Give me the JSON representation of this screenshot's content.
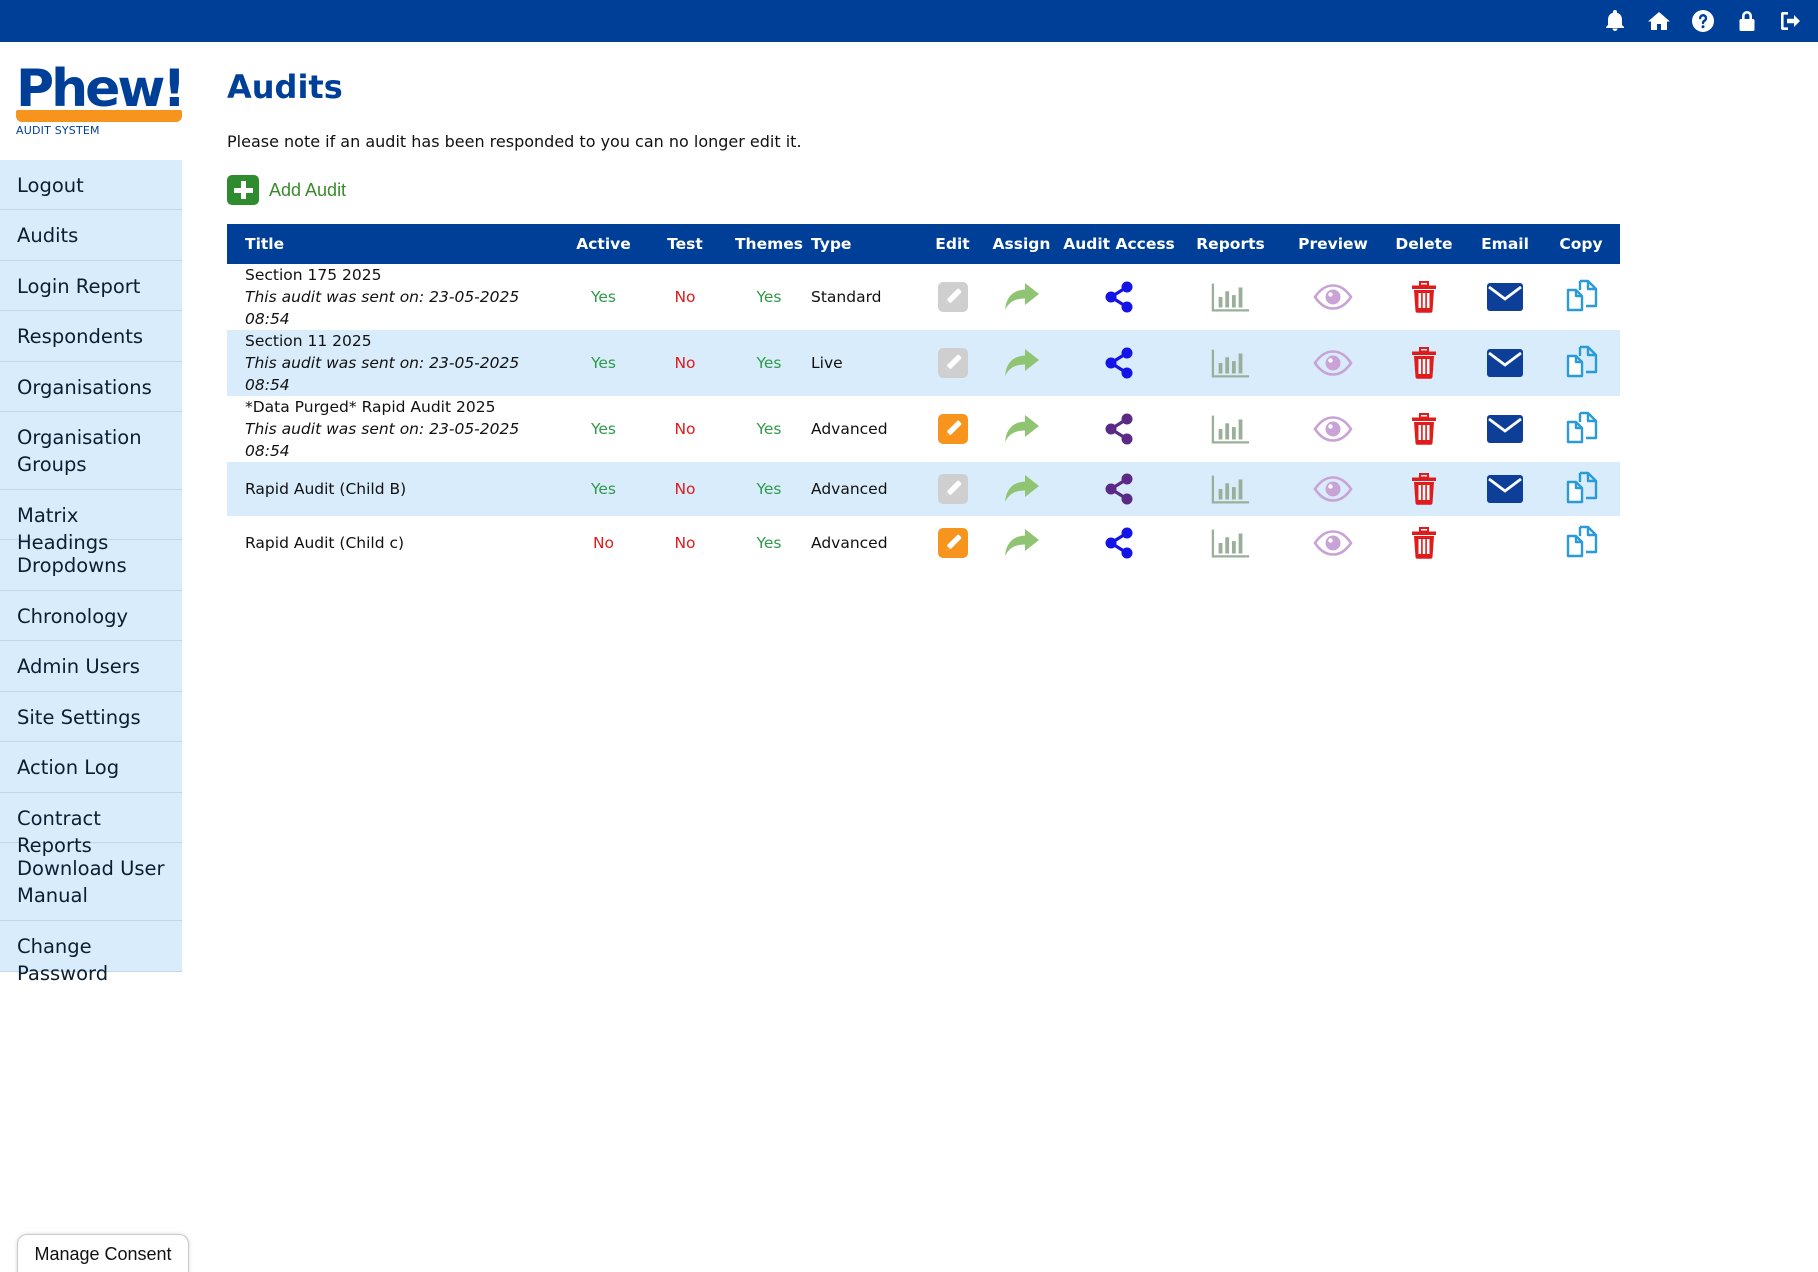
{
  "topbar": {
    "icons": [
      "bell-icon",
      "home-icon",
      "help-icon",
      "lock-icon",
      "logout-icon"
    ]
  },
  "logo": {
    "word": "Phew!",
    "sub": "AUDIT SYSTEM"
  },
  "sidebar": {
    "items": [
      "Logout",
      "Audits",
      "Login Report",
      "Respondents",
      "Organisations",
      "Organisation Groups",
      "Matrix Headings",
      "Dropdowns",
      "Chronology",
      "Admin Users",
      "Site Settings",
      "Action Log",
      "Contract Reports",
      "Download User Manual",
      "Change Password"
    ]
  },
  "main": {
    "title": "Audits",
    "note": "Please note if an audit has been responded to you can no longer edit it.",
    "add_label": "Add Audit"
  },
  "table": {
    "headers": [
      "Title",
      "Active",
      "Test",
      "Themes",
      "Type",
      "Edit",
      "Assign",
      "Audit Access",
      "Reports",
      "Preview",
      "Delete",
      "Email",
      "Copy"
    ],
    "rows": [
      {
        "title": "Section 175 2025",
        "sent": "This audit was sent on: 23-05-2025 08:54",
        "active": "Yes",
        "test": "No",
        "themes": "Yes",
        "type": "Standard",
        "editable": false,
        "share_color": "#1414e6",
        "email": true
      },
      {
        "title": "Section 11 2025",
        "sent": "This audit was sent on: 23-05-2025 08:54",
        "active": "Yes",
        "test": "No",
        "themes": "Yes",
        "type": "Live",
        "editable": false,
        "share_color": "#1414e6",
        "email": true
      },
      {
        "title": "*Data Purged* Rapid Audit 2025",
        "sent": "This audit was sent on: 23-05-2025 08:54",
        "active": "Yes",
        "test": "No",
        "themes": "Yes",
        "type": "Advanced",
        "editable": true,
        "share_color": "#5b2a86",
        "email": true
      },
      {
        "title": "Rapid Audit (Child B)",
        "sent": "",
        "active": "Yes",
        "test": "No",
        "themes": "Yes",
        "type": "Advanced",
        "editable": false,
        "share_color": "#5b2a86",
        "email": true
      },
      {
        "title": "Rapid Audit (Child c)",
        "sent": "",
        "active": "No",
        "test": "No",
        "themes": "Yes",
        "type": "Advanced",
        "editable": true,
        "share_color": "#1414e6",
        "email": false
      }
    ]
  },
  "consent": {
    "label": "Manage Consent"
  },
  "colors": {
    "brand": "#003f98",
    "accent": "#f7941d",
    "sidebar_bg": "#d9ecfb",
    "yes": "#2e9a4a",
    "no": "#e01b1b"
  }
}
